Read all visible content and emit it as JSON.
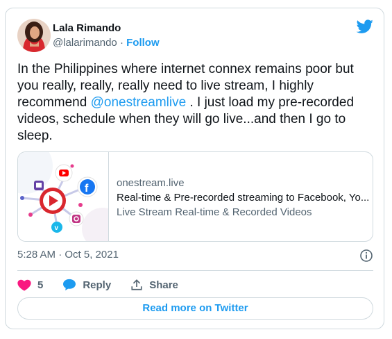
{
  "author": {
    "name": "Lala Rimando",
    "handle": "@lalarimando",
    "separator": "·",
    "follow_label": "Follow"
  },
  "tweet": {
    "text_before": "In the Philippines where internet connex remains poor but you really, really, really need to live stream, I highly recommend ",
    "mention": "@onestreamlive",
    "text_after": " . I just load my pre-recorded videos, schedule when they will go live...and then I go to sleep."
  },
  "link_card": {
    "domain": "onestream.live",
    "title": "Real-time & Pre-recorded streaming to Facebook, Yo...",
    "description": "Live Stream Real-time & Recorded Videos"
  },
  "meta": {
    "timestamp": "5:28 AM · Oct 5, 2021"
  },
  "actions": {
    "like_count": "5",
    "reply_label": "Reply",
    "share_label": "Share"
  },
  "read_more_label": "Read more on Twitter",
  "colors": {
    "accent": "#1d9bf0",
    "like": "#f91880",
    "border": "#cfd9de",
    "muted": "#536471"
  }
}
